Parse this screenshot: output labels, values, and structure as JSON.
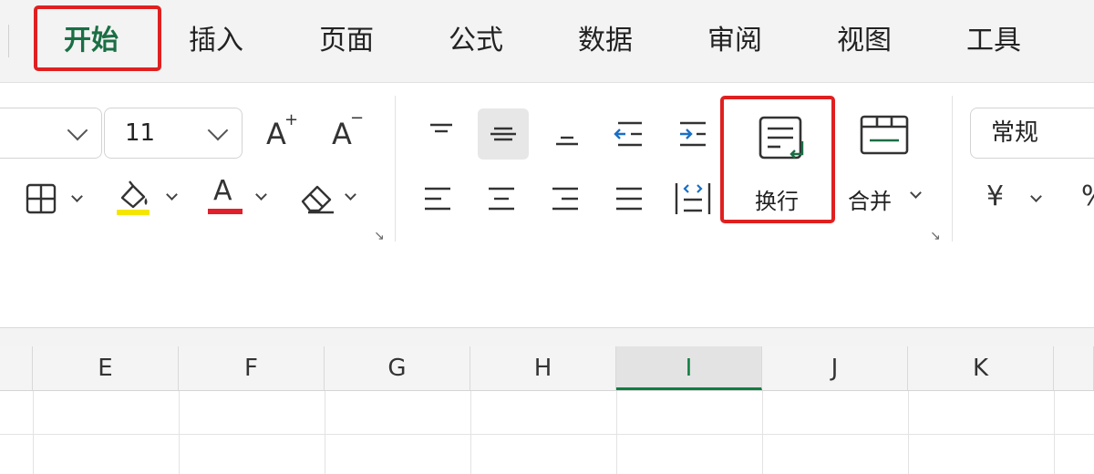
{
  "tabs": [
    {
      "label": "开始",
      "active": true
    },
    {
      "label": "插入"
    },
    {
      "label": "页面"
    },
    {
      "label": "公式"
    },
    {
      "label": "数据"
    },
    {
      "label": "审阅"
    },
    {
      "label": "视图"
    },
    {
      "label": "工具"
    }
  ],
  "font": {
    "size_value": "11",
    "increase_glyph": "A",
    "increase_sup": "+",
    "decrease_glyph": "A",
    "decrease_sup": "−",
    "color_glyph": "A"
  },
  "alignment": {
    "wrap_label": "换行",
    "merge_label": "合并"
  },
  "number": {
    "format_value": "常规",
    "currency_glyph": "¥",
    "percent_glyph": "%"
  },
  "columns": [
    "E",
    "F",
    "G",
    "H",
    "I",
    "J",
    "K"
  ],
  "selected_column": "I",
  "colors": {
    "accent_green": "#1b6e44",
    "highlight_red": "#e02020",
    "fill_yellow": "#f5e600",
    "font_red": "#e0202a",
    "select_green": "#107c41"
  }
}
